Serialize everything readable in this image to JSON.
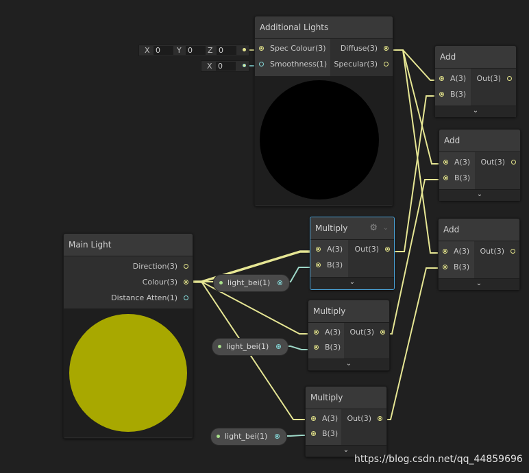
{
  "additional_lights": {
    "title": "Additional Lights",
    "inputs": [
      "Spec Colour(3)",
      "Smoothness(1)"
    ],
    "outputs": [
      "Diffuse(3)",
      "Specular(3)"
    ],
    "preview_color": "#000000",
    "spec_fields": {
      "x_label": "X",
      "x": "0",
      "y_label": "Y",
      "y": "0",
      "z_label": "Z",
      "z": "0"
    },
    "smooth_field": {
      "x_label": "X",
      "x": "0"
    }
  },
  "main_light": {
    "title": "Main Light",
    "outputs": [
      "Direction(3)",
      "Colour(3)",
      "Distance Atten(1)"
    ],
    "preview_color": "#a8a800"
  },
  "add_nodes": [
    {
      "title": "Add",
      "inputs": [
        "A(3)",
        "B(3)"
      ],
      "output": "Out(3)",
      "expand": "⌄"
    },
    {
      "title": "Add",
      "inputs": [
        "A(3)",
        "B(3)"
      ],
      "output": "Out(3)",
      "expand": "⌄"
    },
    {
      "title": "Add",
      "inputs": [
        "A(3)",
        "B(3)"
      ],
      "output": "Out(3)",
      "expand": "⌄"
    }
  ],
  "multiply_nodes": [
    {
      "title": "Multiply",
      "inputs": [
        "A(3)",
        "B(3)"
      ],
      "output": "Out(3)",
      "expand": "⌄",
      "selected": true
    },
    {
      "title": "Multiply",
      "inputs": [
        "A(3)",
        "B(3)"
      ],
      "output": "Out(3)",
      "expand": "⌄"
    },
    {
      "title": "Multiply",
      "inputs": [
        "A(3)",
        "B(3)"
      ],
      "output": "Out(3)",
      "expand": "⌄"
    }
  ],
  "properties": [
    {
      "label": "light_bei(1)"
    },
    {
      "label": "light_bei(1)"
    },
    {
      "label": "light_bei(1)"
    }
  ],
  "icons": {
    "settings": "gear-icon",
    "expand": "chevron-down-icon"
  },
  "colors": {
    "vector_wire": "#e6e694",
    "float_wire": "#9ed8c8",
    "selection": "#4aa3d8"
  },
  "watermark": "https://blog.csdn.net/qq_44859696"
}
